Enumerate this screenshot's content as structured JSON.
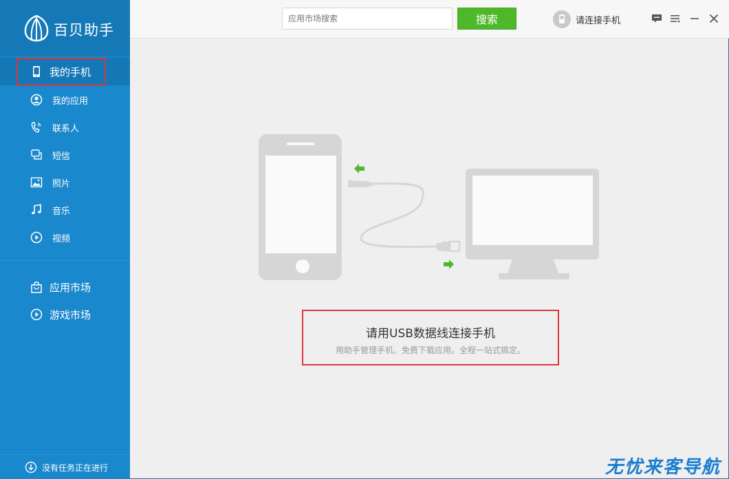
{
  "app": {
    "name": "百贝助手",
    "colors": {
      "sidebar": "#1a88cc",
      "active": "#1578b6",
      "accent_green": "#4fb82a",
      "highlight_red": "#d9363b"
    }
  },
  "sidebar": {
    "my_phone": {
      "label": "我的手机",
      "icon": "phone-icon"
    },
    "items": [
      {
        "label": "我的应用",
        "icon": "user-circle-icon"
      },
      {
        "label": "联系人",
        "icon": "phone-call-icon"
      },
      {
        "label": "短信",
        "icon": "message-icon"
      },
      {
        "label": "照片",
        "icon": "image-icon"
      },
      {
        "label": "音乐",
        "icon": "music-note-icon"
      },
      {
        "label": "视频",
        "icon": "play-circle-icon"
      }
    ],
    "market_items": [
      {
        "label": "应用市场",
        "icon": "shopping-bag-icon"
      },
      {
        "label": "游戏市场",
        "icon": "play-circle-icon"
      }
    ],
    "footer": {
      "label": "没有任务正在进行",
      "icon": "download-icon"
    }
  },
  "topbar": {
    "search_placeholder": "应用市场搜索",
    "search_button": "搜索",
    "device_status": "请连接手机",
    "icons": [
      "feedback-icon",
      "menu-icon",
      "minimize-icon",
      "close-icon"
    ]
  },
  "main": {
    "title": "请用USB数据线连接手机",
    "subtitle": "用助手管理手机、免费下载应用。全程一站式搞定。"
  },
  "watermark": "无忧来客导航"
}
